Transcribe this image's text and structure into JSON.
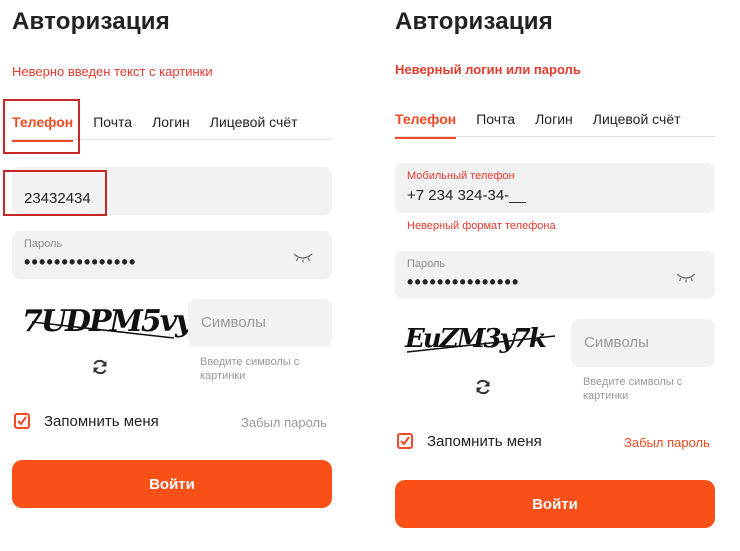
{
  "left": {
    "title": "Авторизация",
    "error": "Неверно введен текст с картинки",
    "tabs": [
      "Телефон",
      "Почта",
      "Логин",
      "Лицевой счёт"
    ],
    "phone_value": "23432434",
    "password_label": "Пароль",
    "password_dots": "•••••••••••••••",
    "captcha_text": "7UDPM5vy",
    "captcha_placeholder": "Символы",
    "captcha_hint_1": "Введите символы с",
    "captcha_hint_2": "картинки",
    "remember": "Запомнить меня",
    "remember_checked": true,
    "forgot": "Забыл пароль",
    "submit": "Войти",
    "eye_icon": "eye-closed-icon",
    "refresh_icon": "refresh-icon"
  },
  "right": {
    "title": "Авторизация",
    "error": "Неверный логин или пароль",
    "tabs": [
      "Телефон",
      "Почта",
      "Логин",
      "Лицевой счёт"
    ],
    "phone_label": "Мобильный телефон",
    "phone_value": "+7 234 324-34-__",
    "phone_error": "Неверный формат телефона",
    "password_label": "Пароль",
    "password_dots": "•••••••••••••••",
    "captcha_text": "EuZM3y7k",
    "captcha_placeholder": "Символы",
    "captcha_hint_1": "Введите символы с",
    "captcha_hint_2": "картинки",
    "remember": "Запомнить меня",
    "remember_checked": true,
    "forgot": "Забыл пароль",
    "submit": "Войти",
    "eye_icon": "eye-closed-icon",
    "refresh_icon": "refresh-icon"
  },
  "colors": {
    "accent": "#ef4a23",
    "button": "#fa4f17",
    "error": "#e33b2e",
    "highlight_box": "#c62828",
    "field_bg": "#f2f2f2"
  }
}
